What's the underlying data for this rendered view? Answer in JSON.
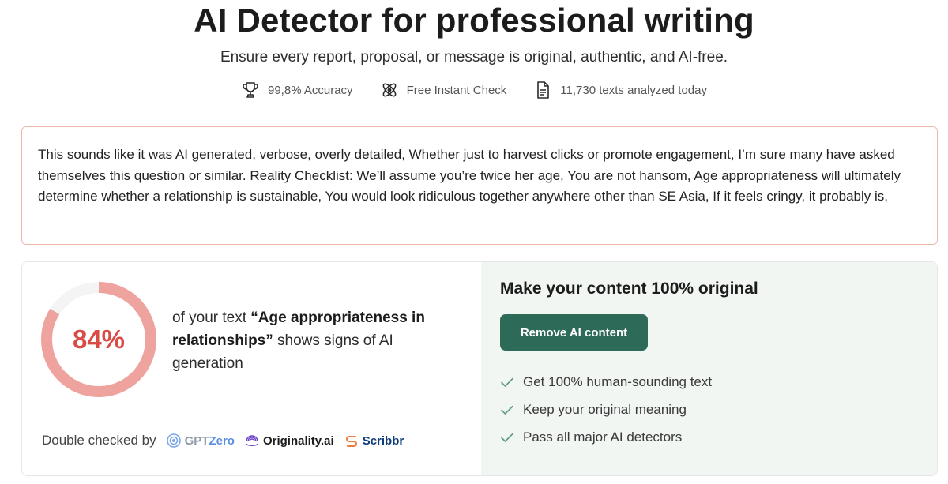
{
  "hero": {
    "title": "AI Detector for professional writing",
    "subtitle": "Ensure every report, proposal, or message is original, authentic, and AI-free."
  },
  "features": [
    {
      "icon": "trophy-icon",
      "label": "99,8% Accuracy"
    },
    {
      "icon": "atom-icon",
      "label": "Free Instant Check"
    },
    {
      "icon": "document-icon",
      "label": "11,730 texts analyzed today"
    }
  ],
  "input_text": "This sounds like it was AI generated, verbose, overly detailed, Whether just to harvest clicks or promote engagement, I’m sure many have asked themselves this question or similar. Reality Checklist: We’ll assume you’re twice her age, You are not hansom, Age appropriateness will ultimately determine whether a relationship is sustainable, You would look ridiculous together anywhere other than SE Asia, If it feels cringy, it probably is,",
  "result": {
    "score": 84,
    "score_label": "84%",
    "prefix": "of your text ",
    "topic": "“Age appropriateness in relationships”",
    "suffix": " shows signs of AI generation",
    "checked_by_label": "Double checked by",
    "checkers": [
      {
        "icon": "gptzero-logo-icon",
        "prefix": "GPT",
        "name": "Zero"
      },
      {
        "icon": "originality-logo-icon",
        "name": "Originality.ai"
      },
      {
        "icon": "scribbr-logo-icon",
        "name": "Scribbr"
      }
    ],
    "colors": {
      "ring_fill": "#eea39f",
      "ring_track": "#f4f4f4",
      "score_text": "#d94c46"
    }
  },
  "cta": {
    "title": "Make your content 100% original",
    "button_label": "Remove AI content",
    "benefits": [
      "Get 100% human-sounding text",
      "Keep your original meaning",
      "Pass all major AI detectors"
    ],
    "colors": {
      "button": "#2d6a58",
      "panel": "#f1f6f3",
      "check": "#5f9a86"
    }
  }
}
